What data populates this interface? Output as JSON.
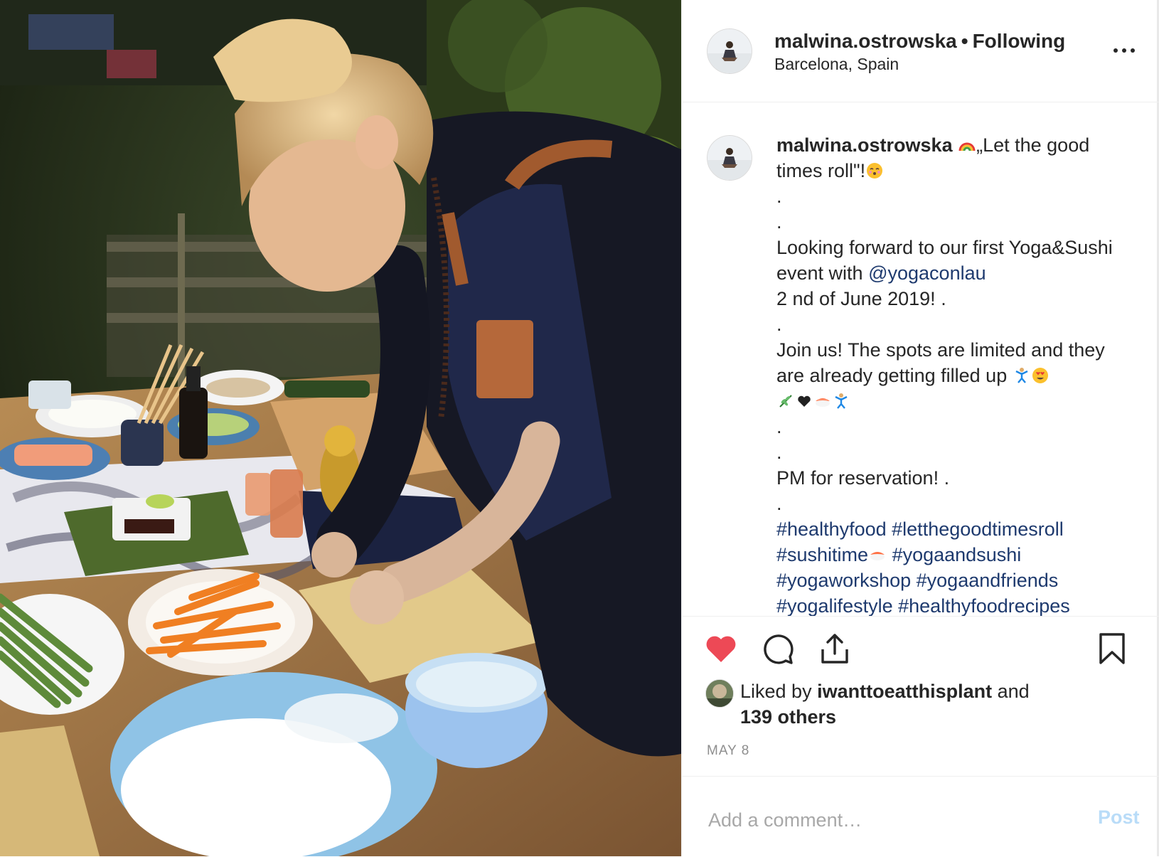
{
  "post": {
    "username": "malwina.ostrowska",
    "separator": "•",
    "follow_status": "Following",
    "location": "Barcelona, Spain",
    "photo_description_icon": "sushi-making-photo"
  },
  "caption": {
    "username": "malwina.ostrowska",
    "line1": "„Let the good times roll\"!",
    "dot": ".",
    "line2": "Looking forward to our first Yoga&Sushi event with",
    "mention": "@yogaconlau",
    "line3": "2 nd of June 2019! .",
    "line4": "Join us! The spots are limited and they are already getting filled up",
    "line5": "PM for reservation! .",
    "hashtags": [
      "#healthyfood",
      "#letthegoodtimesroll",
      "#sushitime",
      "#yogaandsushi",
      "#yogaworkshop",
      "#yogaandfriends",
      "#yogalifestyle",
      "#healthyfoodrecipes"
    ]
  },
  "actions": {
    "like_icon": "heart-filled-icon",
    "comment_icon": "comment-bubble-icon",
    "share_icon": "share-upload-icon",
    "save_icon": "bookmark-icon",
    "like_color": "#ed4956"
  },
  "likes": {
    "prefix": "Liked by",
    "liker": "iwanttoeatthisplant",
    "connector": "and",
    "others": "139 others"
  },
  "date": "MAY 8",
  "comment": {
    "placeholder": "Add a comment…",
    "post_label": "Post",
    "post_color": "#b9dcf8"
  }
}
